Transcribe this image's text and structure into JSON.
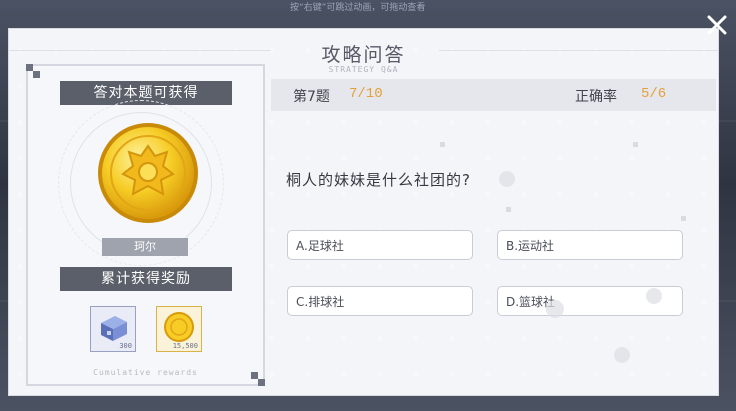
{
  "top_hint": "按“右键”可跳过动画，可拖动查看",
  "dialog": {
    "title": "攻略问答",
    "subtitle": "STRATEGY Q&A",
    "close_icon": "close-x-icon"
  },
  "reward": {
    "banner_title": "答对本题可获得",
    "coin_name": "珂尔",
    "cumulative_title": "累计获得奖励",
    "items": [
      {
        "icon": "cube-material-icon",
        "count": "300"
      },
      {
        "icon": "gold-coin-icon",
        "count": "15,500"
      }
    ],
    "footer": "Cumulative rewards"
  },
  "quiz": {
    "question_label": "第7题",
    "question_progress": "7/10",
    "accuracy_label": "正确率",
    "accuracy_value": "5/6",
    "question": "桐人的妹妹是什么社团的?",
    "options": [
      {
        "id": "A",
        "text": "A.足球社"
      },
      {
        "id": "B",
        "text": "B.运动社"
      },
      {
        "id": "C",
        "text": "C.排球社"
      },
      {
        "id": "D",
        "text": "D.篮球社"
      }
    ]
  },
  "colors": {
    "accent": "#e4a13a",
    "banner": "#5b5f69",
    "panel": "#f4f5f9"
  }
}
